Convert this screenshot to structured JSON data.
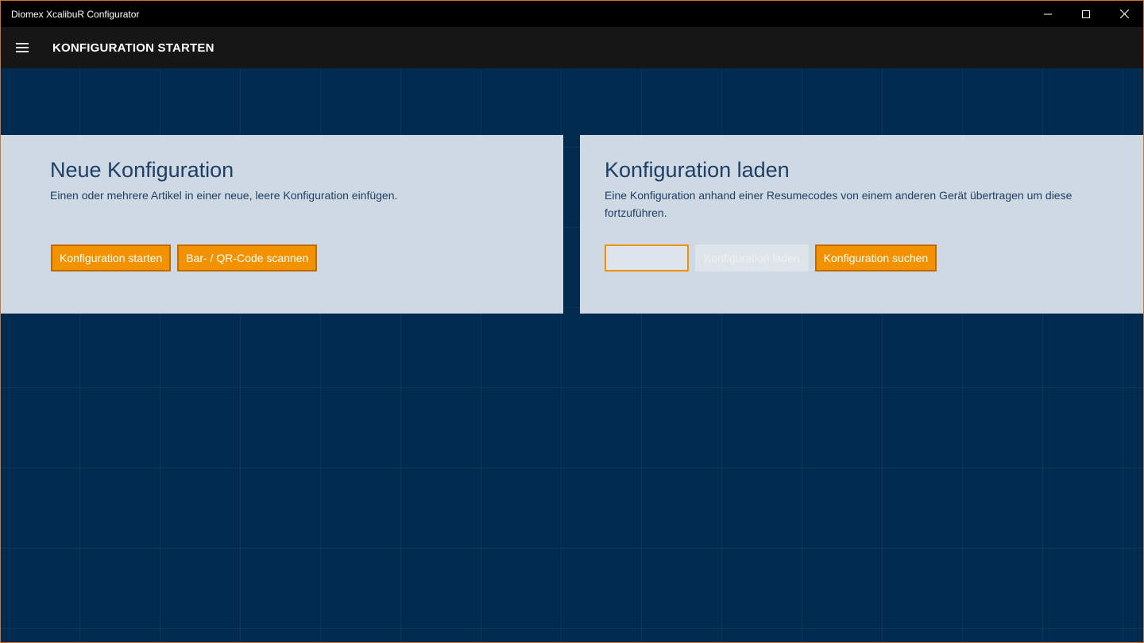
{
  "window": {
    "title": "Diomex XcalibuR Configurator",
    "controls": [
      "minimize-icon",
      "maximize-icon",
      "close-icon"
    ]
  },
  "appbar": {
    "menu_icon": "hamburger-menu-icon",
    "heading": "KONFIGURATION STARTEN"
  },
  "new_config": {
    "title": "Neue Konfiguration",
    "description": "Einen oder mehrere Artikel in einer neue, leere Konfiguration einfügen.",
    "start_label": "Konfiguration starten",
    "scan_label": "Bar- / QR-Code scannen"
  },
  "load_config": {
    "title": "Konfiguration laden",
    "description": "Eine Konfiguration anhand einer Resumecodes von einem anderen Gerät übertragen um diese fortzuführen.",
    "input_value": "",
    "load_label": "Konfiguration laden",
    "search_label": "Konfiguration suchen"
  },
  "colors": {
    "accent": "#f39200",
    "panel": "#cfd9e3",
    "background": "#002a4e",
    "text": "#1e3f66"
  }
}
